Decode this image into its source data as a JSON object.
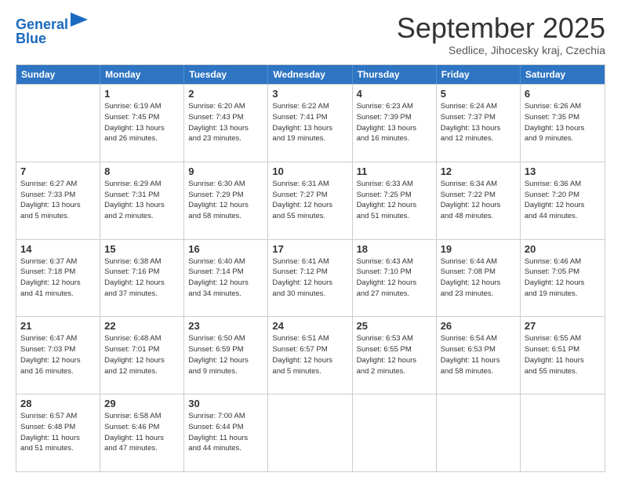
{
  "logo": {
    "line1": "General",
    "line2": "Blue",
    "icon": "▶"
  },
  "title": "September 2025",
  "location": "Sedlice, Jihocesky kraj, Czechia",
  "header_days": [
    "Sunday",
    "Monday",
    "Tuesday",
    "Wednesday",
    "Thursday",
    "Friday",
    "Saturday"
  ],
  "weeks": [
    [
      {
        "day": "",
        "info": ""
      },
      {
        "day": "1",
        "info": "Sunrise: 6:19 AM\nSunset: 7:45 PM\nDaylight: 13 hours\nand 26 minutes."
      },
      {
        "day": "2",
        "info": "Sunrise: 6:20 AM\nSunset: 7:43 PM\nDaylight: 13 hours\nand 23 minutes."
      },
      {
        "day": "3",
        "info": "Sunrise: 6:22 AM\nSunset: 7:41 PM\nDaylight: 13 hours\nand 19 minutes."
      },
      {
        "day": "4",
        "info": "Sunrise: 6:23 AM\nSunset: 7:39 PM\nDaylight: 13 hours\nand 16 minutes."
      },
      {
        "day": "5",
        "info": "Sunrise: 6:24 AM\nSunset: 7:37 PM\nDaylight: 13 hours\nand 12 minutes."
      },
      {
        "day": "6",
        "info": "Sunrise: 6:26 AM\nSunset: 7:35 PM\nDaylight: 13 hours\nand 9 minutes."
      }
    ],
    [
      {
        "day": "7",
        "info": "Sunrise: 6:27 AM\nSunset: 7:33 PM\nDaylight: 13 hours\nand 5 minutes."
      },
      {
        "day": "8",
        "info": "Sunrise: 6:29 AM\nSunset: 7:31 PM\nDaylight: 13 hours\nand 2 minutes."
      },
      {
        "day": "9",
        "info": "Sunrise: 6:30 AM\nSunset: 7:29 PM\nDaylight: 12 hours\nand 58 minutes."
      },
      {
        "day": "10",
        "info": "Sunrise: 6:31 AM\nSunset: 7:27 PM\nDaylight: 12 hours\nand 55 minutes."
      },
      {
        "day": "11",
        "info": "Sunrise: 6:33 AM\nSunset: 7:25 PM\nDaylight: 12 hours\nand 51 minutes."
      },
      {
        "day": "12",
        "info": "Sunrise: 6:34 AM\nSunset: 7:22 PM\nDaylight: 12 hours\nand 48 minutes."
      },
      {
        "day": "13",
        "info": "Sunrise: 6:36 AM\nSunset: 7:20 PM\nDaylight: 12 hours\nand 44 minutes."
      }
    ],
    [
      {
        "day": "14",
        "info": "Sunrise: 6:37 AM\nSunset: 7:18 PM\nDaylight: 12 hours\nand 41 minutes."
      },
      {
        "day": "15",
        "info": "Sunrise: 6:38 AM\nSunset: 7:16 PM\nDaylight: 12 hours\nand 37 minutes."
      },
      {
        "day": "16",
        "info": "Sunrise: 6:40 AM\nSunset: 7:14 PM\nDaylight: 12 hours\nand 34 minutes."
      },
      {
        "day": "17",
        "info": "Sunrise: 6:41 AM\nSunset: 7:12 PM\nDaylight: 12 hours\nand 30 minutes."
      },
      {
        "day": "18",
        "info": "Sunrise: 6:43 AM\nSunset: 7:10 PM\nDaylight: 12 hours\nand 27 minutes."
      },
      {
        "day": "19",
        "info": "Sunrise: 6:44 AM\nSunset: 7:08 PM\nDaylight: 12 hours\nand 23 minutes."
      },
      {
        "day": "20",
        "info": "Sunrise: 6:46 AM\nSunset: 7:05 PM\nDaylight: 12 hours\nand 19 minutes."
      }
    ],
    [
      {
        "day": "21",
        "info": "Sunrise: 6:47 AM\nSunset: 7:03 PM\nDaylight: 12 hours\nand 16 minutes."
      },
      {
        "day": "22",
        "info": "Sunrise: 6:48 AM\nSunset: 7:01 PM\nDaylight: 12 hours\nand 12 minutes."
      },
      {
        "day": "23",
        "info": "Sunrise: 6:50 AM\nSunset: 6:59 PM\nDaylight: 12 hours\nand 9 minutes."
      },
      {
        "day": "24",
        "info": "Sunrise: 6:51 AM\nSunset: 6:57 PM\nDaylight: 12 hours\nand 5 minutes."
      },
      {
        "day": "25",
        "info": "Sunrise: 6:53 AM\nSunset: 6:55 PM\nDaylight: 12 hours\nand 2 minutes."
      },
      {
        "day": "26",
        "info": "Sunrise: 6:54 AM\nSunset: 6:53 PM\nDaylight: 11 hours\nand 58 minutes."
      },
      {
        "day": "27",
        "info": "Sunrise: 6:55 AM\nSunset: 6:51 PM\nDaylight: 11 hours\nand 55 minutes."
      }
    ],
    [
      {
        "day": "28",
        "info": "Sunrise: 6:57 AM\nSunset: 6:48 PM\nDaylight: 11 hours\nand 51 minutes."
      },
      {
        "day": "29",
        "info": "Sunrise: 6:58 AM\nSunset: 6:46 PM\nDaylight: 11 hours\nand 47 minutes."
      },
      {
        "day": "30",
        "info": "Sunrise: 7:00 AM\nSunset: 6:44 PM\nDaylight: 11 hours\nand 44 minutes."
      },
      {
        "day": "",
        "info": ""
      },
      {
        "day": "",
        "info": ""
      },
      {
        "day": "",
        "info": ""
      },
      {
        "day": "",
        "info": ""
      }
    ]
  ]
}
